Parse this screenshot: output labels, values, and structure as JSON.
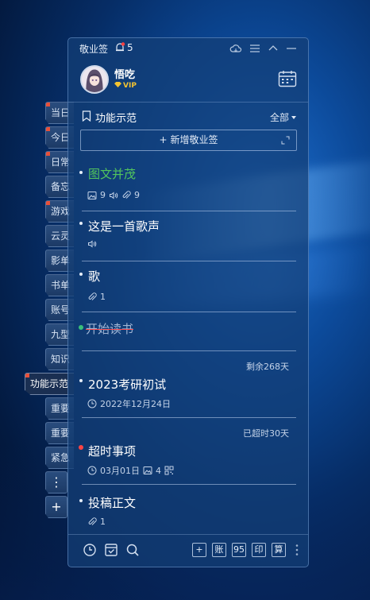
{
  "side_tabs": [
    {
      "label": "当日",
      "marked": true
    },
    {
      "label": "今日",
      "marked": true
    },
    {
      "label": "日常",
      "marked": true
    },
    {
      "label": "备忘",
      "marked": false
    },
    {
      "label": "游戏",
      "marked": true
    },
    {
      "label": "云灵",
      "marked": false
    },
    {
      "label": "影单",
      "marked": false
    },
    {
      "label": "书单",
      "marked": false
    },
    {
      "label": "账号",
      "marked": false
    },
    {
      "label": "九型",
      "marked": false
    },
    {
      "label": "知识",
      "marked": false
    },
    {
      "label": "功能示范",
      "marked": true,
      "active": true
    },
    {
      "label": "重要",
      "marked": false
    },
    {
      "label": "重要",
      "marked": false
    },
    {
      "label": "紧急",
      "marked": false
    }
  ],
  "side_more_label": "⋮",
  "side_add_label": "+",
  "app": {
    "name": "敬业签",
    "notification_count": "5"
  },
  "user": {
    "name": "悟吃",
    "badge": "VIP"
  },
  "list": {
    "title": "功能示范",
    "filter": "全部",
    "add_label": "新增敬业签"
  },
  "items": [
    {
      "title": "图文并茂",
      "meta": {
        "images": "9",
        "files": "9"
      }
    },
    {
      "title": "这是一首歌声"
    },
    {
      "title": "歌",
      "meta": {
        "files": "1"
      }
    },
    {
      "title": "开始读书"
    },
    {
      "title": "2023考研初试",
      "countdown": "剩余268天",
      "date": "2022年12月24日"
    },
    {
      "title": "超时事项",
      "countdown": "已超时30天",
      "date": "03月01日",
      "images": "4"
    },
    {
      "title": "投稿正文",
      "meta": {
        "files": "1"
      }
    }
  ],
  "bottom": {
    "buttons": [
      "+",
      "账",
      "95",
      "印",
      "算"
    ]
  },
  "colors": {
    "panel": "#143e76",
    "done_strike": "#ff4c4c",
    "green_title": "#52c55d",
    "vip": "#f4c431",
    "overdue_dot": "#ff4444"
  }
}
